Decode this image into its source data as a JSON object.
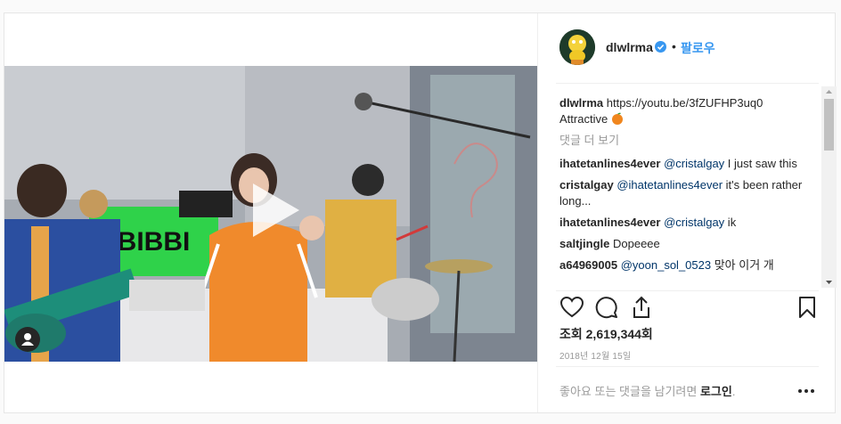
{
  "post": {
    "username": "dlwlrma",
    "follow_label": "팔로우",
    "dot": "•",
    "caption": {
      "username": "dlwlrma",
      "link": "https://youtu.be/3fZUFHP3uq0",
      "text": "Attractive"
    },
    "view_more_comments": "댓글 더 보기",
    "comments": [
      {
        "user": "ihatetanlines4ever",
        "mention": "@cristalgay",
        "text": " I just saw this"
      },
      {
        "user": "cristalgay",
        "mention": "@ihatetanlines4ever",
        "text": " it's been rather long..."
      },
      {
        "user": "ihatetanlines4ever",
        "mention": "@cristalgay",
        "text": " ik"
      },
      {
        "user": "saltjingle",
        "mention": "",
        "text": "Dopeeee"
      },
      {
        "user": "a64969005",
        "mention": "@yoon_sol_0523",
        "text": " 맞아 이거 개"
      }
    ],
    "views_label": "조회 2,619,344회",
    "date": "2018년 12월 15일",
    "footer_text": "좋아요 또는 댓글을 남기려면 ",
    "footer_login": "로그인",
    "footer_end": ".",
    "media_sign_text": "BBIBBI"
  },
  "colors": {
    "accent": "#3897f0",
    "verified": "#3897f0",
    "text": "#262626",
    "muted": "#999999"
  },
  "icons": [
    "verified-badge-icon",
    "play-icon",
    "user-tag-icon",
    "heart-icon",
    "comment-icon",
    "share-icon",
    "bookmark-icon",
    "more-options-icon"
  ]
}
